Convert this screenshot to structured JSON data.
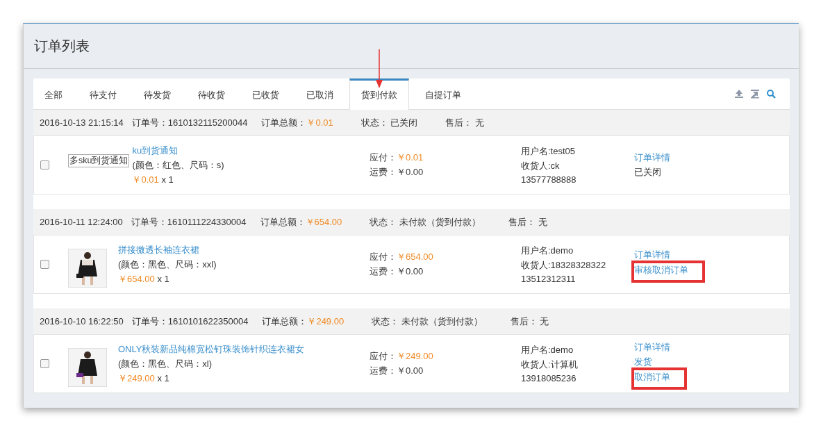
{
  "window": {
    "title": "订单列表"
  },
  "tabs": [
    {
      "label": "全部",
      "selected": false
    },
    {
      "label": "待支付",
      "selected": false
    },
    {
      "label": "待发货",
      "selected": false
    },
    {
      "label": "待收货",
      "selected": false
    },
    {
      "label": "已收货",
      "selected": false
    },
    {
      "label": "已取消",
      "selected": false
    },
    {
      "label": "货到付款",
      "selected": true,
      "annotated": true
    },
    {
      "label": "自提订单",
      "selected": false
    }
  ],
  "orders": [
    {
      "time": "2016-10-13 21:15:14",
      "number_label": "订单号：",
      "number": "1610132115200044",
      "total_label": "订单总额：",
      "total": "￥0.01",
      "status_label": "状态：",
      "status": "已关闭",
      "after_sale_label": "售后：",
      "after_sale": "无",
      "checked": false,
      "image": {
        "kind": "broken",
        "alt": "多sku到货通知"
      },
      "title": "ku到货通知",
      "spec": "(颜色：红色、尺码：s)",
      "price": "￥0.01",
      "qty": "x 1",
      "pay_label": "应付：",
      "pay": "￥0.01",
      "ship_label": "运费：",
      "ship": "￥0.00",
      "user": "用户名:test05",
      "receiver": "收货人:ck",
      "phone": "13577788888",
      "actions": [
        {
          "kind": "link",
          "label": "订单详情",
          "highlighted": false
        },
        {
          "kind": "text",
          "label": "已关闭",
          "highlighted": false
        }
      ]
    },
    {
      "time": "2016-10-11 12:24:00",
      "number_label": "订单号：",
      "number": "1610111224330004",
      "total_label": "订单总额：",
      "total": "￥654.00",
      "status_label": "状态：",
      "status": "未付款（货到付款）",
      "after_sale_label": "售后：",
      "after_sale": "无",
      "checked": false,
      "image": {
        "kind": "picture"
      },
      "title": "拼接微透长袖连衣裙",
      "spec": "(颜色：黑色、尺码：xxl)",
      "price": "￥654.00",
      "qty": "x 1",
      "pay_label": "应付：",
      "pay": "￥654.00",
      "ship_label": "运费：",
      "ship": "￥0.00",
      "user": "用户名:demo",
      "receiver": "收货人:18328328322",
      "phone": "13512312311",
      "actions": [
        {
          "kind": "link",
          "label": "订单详情",
          "highlighted": false
        },
        {
          "kind": "link",
          "label": "审核取消订单",
          "highlighted": true
        }
      ]
    },
    {
      "time": "2016-10-10 16:22:50",
      "number_label": "订单号：",
      "number": "1610101622350004",
      "total_label": "订单总额：",
      "total": "￥249.00",
      "status_label": "状态：",
      "status": "未付款（货到付款）",
      "after_sale_label": "售后：",
      "after_sale": "无",
      "checked": false,
      "image": {
        "kind": "picture"
      },
      "title": "ONLY秋装新品纯棉宽松钉珠装饰针织连衣裙女",
      "spec": "(颜色：黑色、尺码：xl)",
      "price": "￥249.00",
      "qty": "x 1",
      "pay_label": "应付：",
      "pay": "￥249.00",
      "ship_label": "运费：",
      "ship": "￥0.00",
      "user": "用户名:demo",
      "receiver": "收货人:计算机",
      "phone": "13918085236",
      "actions": [
        {
          "kind": "link",
          "label": "订单详情",
          "highlighted": false
        },
        {
          "kind": "link",
          "label": "发货",
          "highlighted": false
        },
        {
          "kind": "link",
          "label": "取消订单",
          "highlighted": true
        }
      ]
    }
  ]
}
